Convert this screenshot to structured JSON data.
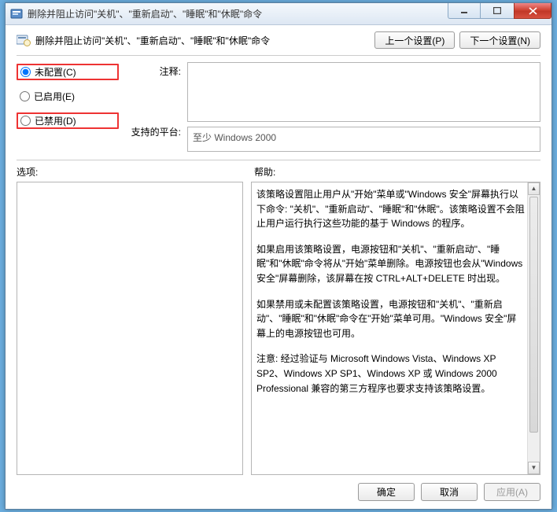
{
  "window": {
    "title": "删除并阻止访问\"关机\"、\"重新启动\"、\"睡眠\"和\"休眠\"命令"
  },
  "header": {
    "policy_title": "删除并阻止访问\"关机\"、\"重新启动\"、\"睡眠\"和\"休眠\"命令",
    "prev_btn": "上一个设置(P)",
    "next_btn": "下一个设置(N)"
  },
  "radios": {
    "not_configured": "未配置(C)",
    "enabled": "已启用(E)",
    "disabled": "已禁用(D)",
    "selected": "not_configured"
  },
  "labels": {
    "comment": "注释:",
    "platform": "支持的平台:",
    "options": "选项:",
    "help": "帮助:"
  },
  "fields": {
    "comment_value": "",
    "platform_value": "至少 Windows 2000"
  },
  "help": {
    "p1": "该策略设置阻止用户从\"开始\"菜单或\"Windows 安全\"屏幕执行以下命令: \"关机\"、\"重新启动\"、\"睡眠\"和\"休眠\"。该策略设置不会阻止用户运行执行这些功能的基于 Windows 的程序。",
    "p2": "如果启用该策略设置，电源按钮和\"关机\"、\"重新启动\"、\"睡眠\"和\"休眠\"命令将从\"开始\"菜单删除。电源按钮也会从\"Windows 安全\"屏幕删除，该屏幕在按 CTRL+ALT+DELETE 时出现。",
    "p3": "如果禁用或未配置该策略设置，电源按钮和\"关机\"、\"重新启动\"、\"睡眠\"和\"休眠\"命令在\"开始\"菜单可用。\"Windows 安全\"屏幕上的电源按钮也可用。",
    "p4": "注意: 经过验证与 Microsoft Windows Vista、Windows XP SP2、Windows XP SP1、Windows XP 或 Windows 2000 Professional 兼容的第三方程序也要求支持该策略设置。"
  },
  "footer": {
    "ok": "确定",
    "cancel": "取消",
    "apply": "应用(A)"
  }
}
